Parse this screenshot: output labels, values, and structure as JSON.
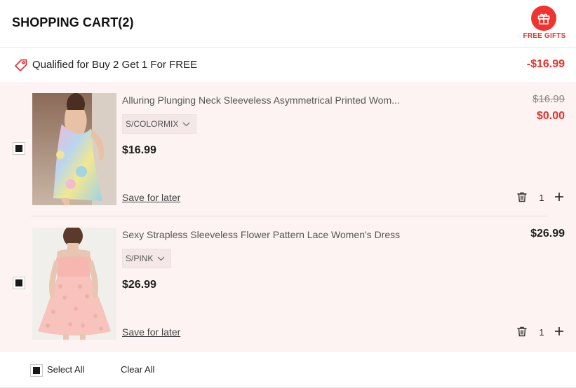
{
  "header": {
    "title": "SHOPPING CART(2)",
    "gift_label": "FREE GIFTS",
    "gift_icon": "gift-icon"
  },
  "promo": {
    "text": "Qualified for Buy 2 Get 1 For FREE",
    "discount": "-$16.99",
    "icon": "tag-icon"
  },
  "items": [
    {
      "name": "Alluring Plunging Neck Sleeveless Asymmetrical Printed Wom...",
      "variant": "S/COLORMIX",
      "price": "$16.99",
      "original_price": "$16.99",
      "final_price": "$0.00",
      "save_label": "Save for later",
      "quantity": "1",
      "checked": true
    },
    {
      "name": "Sexy Strapless Sleeveless Flower Pattern Lace Women's Dress",
      "variant": "S/PINK",
      "price": "$26.99",
      "final_price": "$26.99",
      "save_label": "Save for later",
      "quantity": "1",
      "checked": true
    }
  ],
  "footer": {
    "select_all": "Select All",
    "clear_all": "Clear All"
  },
  "colors": {
    "accent_red": "#e8312c",
    "item_bg": "#fdf3f2"
  }
}
